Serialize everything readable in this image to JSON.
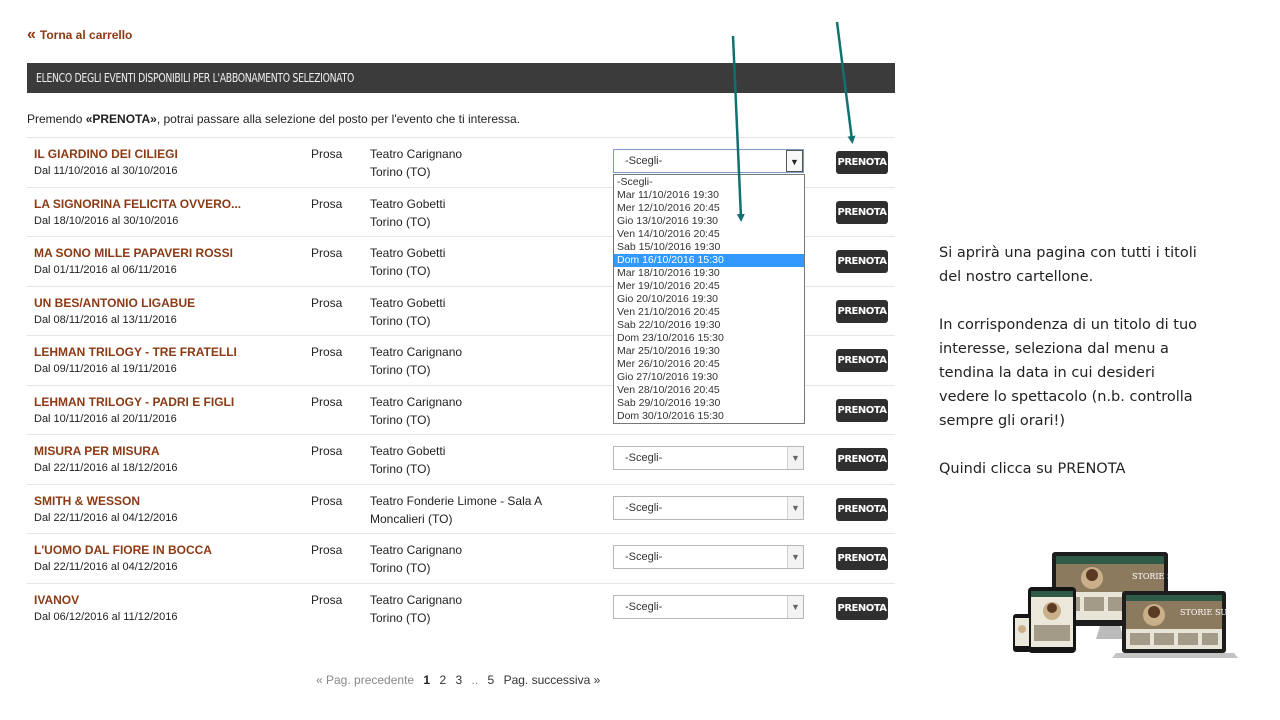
{
  "nav": {
    "back_chevron": "«",
    "back_label": "Torna al carrello"
  },
  "header": {
    "title": "ELENCO DEGLI EVENTI DISPONIBILI PER L'ABBONAMENTO SELEZIONATO"
  },
  "intro": {
    "before": "Premendo ",
    "bold": "«PRENOTA»",
    "after": ", potrai passare alla selezione del posto per l'evento che ti interessa."
  },
  "select_placeholder": "-Scegli-",
  "book_label": "PRENOTA",
  "events": [
    {
      "title": "IL GIARDINO DEI CILIEGI",
      "dates": "Dal 11/10/2016 al 30/10/2016",
      "genre": "Prosa",
      "venue": "Teatro Carignano",
      "city": "Torino (TO)"
    },
    {
      "title": "LA SIGNORINA FELICITA OVVERO...",
      "dates": "Dal 18/10/2016 al 30/10/2016",
      "genre": "Prosa",
      "venue": "Teatro Gobetti",
      "city": "Torino (TO)"
    },
    {
      "title": "MA SONO MILLE PAPAVERI ROSSI",
      "dates": "Dal 01/11/2016 al 06/11/2016",
      "genre": "Prosa",
      "venue": "Teatro Gobetti",
      "city": "Torino (TO)"
    },
    {
      "title": "UN BES/ANTONIO LIGABUE",
      "dates": "Dal 08/11/2016 al 13/11/2016",
      "genre": "Prosa",
      "venue": "Teatro Gobetti",
      "city": "Torino (TO)"
    },
    {
      "title": "LEHMAN TRILOGY - TRE FRATELLI",
      "dates": "Dal 09/11/2016 al 19/11/2016",
      "genre": "Prosa",
      "venue": "Teatro Carignano",
      "city": "Torino (TO)"
    },
    {
      "title": "LEHMAN TRILOGY - PADRI E FIGLI",
      "dates": "Dal 10/11/2016 al 20/11/2016",
      "genre": "Prosa",
      "venue": "Teatro Carignano",
      "city": "Torino (TO)"
    },
    {
      "title": "MISURA PER MISURA",
      "dates": "Dal 22/11/2016 al 18/12/2016",
      "genre": "Prosa",
      "venue": "Teatro Gobetti",
      "city": "Torino (TO)"
    },
    {
      "title": "SMITH & WESSON",
      "dates": "Dal 22/11/2016 al 04/12/2016",
      "genre": "Prosa",
      "venue": "Teatro Fonderie Limone - Sala A",
      "city": "Moncalieri (TO)"
    },
    {
      "title": "L'UOMO DAL FIORE IN BOCCA",
      "dates": "Dal 22/11/2016 al 04/12/2016",
      "genre": "Prosa",
      "venue": "Teatro Carignano",
      "city": "Torino (TO)"
    },
    {
      "title": "IVANOV",
      "dates": "Dal 06/12/2016 al 11/12/2016",
      "genre": "Prosa",
      "venue": "Teatro Carignano",
      "city": "Torino (TO)"
    }
  ],
  "dropdown": {
    "selected_index": 6,
    "options": [
      "-Scegli-",
      "Mar 11/10/2016 19:30",
      "Mer 12/10/2016 20:45",
      "Gio 13/10/2016 19:30",
      "Ven 14/10/2016 20:45",
      "Sab 15/10/2016 19:30",
      "Dom 16/10/2016 15:30",
      "Mar 18/10/2016 19:30",
      "Mer 19/10/2016 20:45",
      "Gio 20/10/2016 19:30",
      "Ven 21/10/2016 20:45",
      "Sab 22/10/2016 19:30",
      "Dom 23/10/2016 15:30",
      "Mar 25/10/2016 19:30",
      "Mer 26/10/2016 20:45",
      "Gio 27/10/2016 19:30",
      "Ven 28/10/2016 20:45",
      "Sab 29/10/2016 19:30",
      "Dom 30/10/2016 15:30"
    ]
  },
  "pagination": {
    "prev": "« Pag. precedente",
    "current": "1",
    "p2": "2",
    "p3": "3",
    "ellipsis": "..",
    "p5": "5",
    "next": "Pag. successiva »"
  },
  "instructions": {
    "p1": "Si aprirà una pagina con tutti i titoli del nostro cartellone.",
    "p2": "In corrispondenza di un titolo di tuo interesse, seleziona dal menu a tendina la data in cui desideri vedere lo spettacolo (n.b. controlla sempre gli orari!)",
    "p3": "Quindi clicca su PRENOTA"
  },
  "colors": {
    "accent_title": "#8b3a14",
    "header_bg": "#3b3b3b",
    "button_bg": "#2f2f2f",
    "arrow": "#0f7270",
    "highlight": "#3399ff"
  },
  "device_image": {
    "screen_title": "STORIE SU MISURA"
  }
}
